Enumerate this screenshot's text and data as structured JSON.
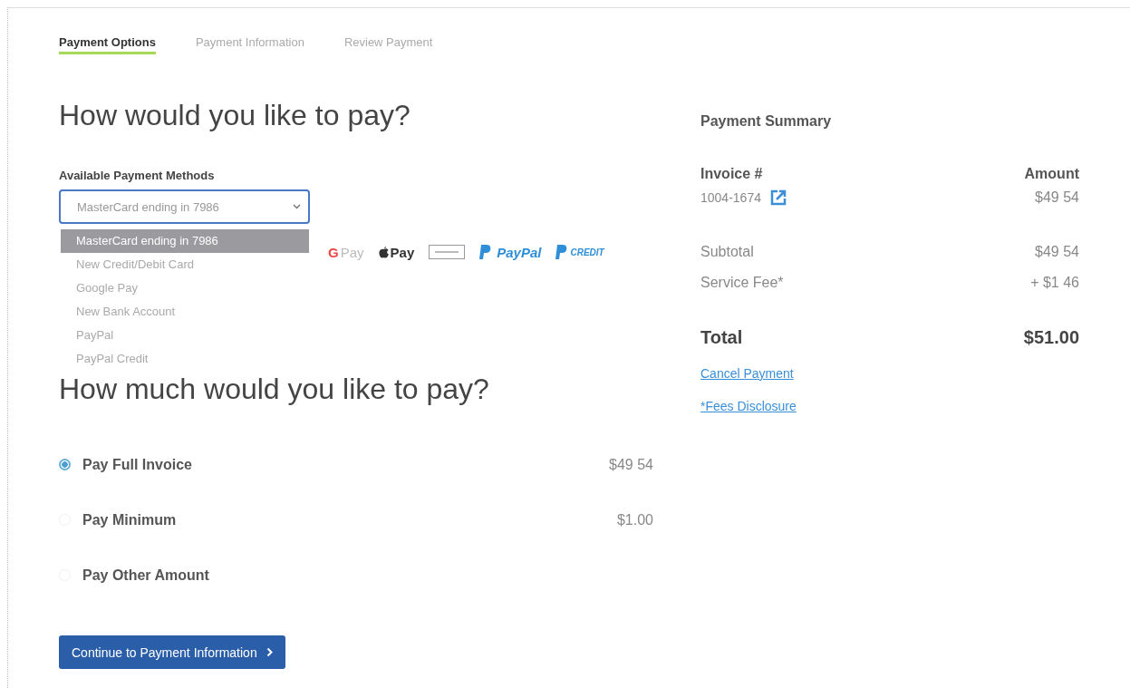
{
  "tabs": [
    {
      "label": "Payment Options",
      "selected": true
    },
    {
      "label": "Payment Information",
      "selected": false
    },
    {
      "label": "Review Payment",
      "selected": false
    }
  ],
  "method_section": {
    "heading": "How would you like to pay?",
    "label": "Available Payment Methods",
    "select": {
      "value": "MasterCard ending in 7986",
      "expanded": true
    },
    "options": [
      {
        "label": "MasterCard ending in 7986",
        "selected": true
      },
      {
        "label": "New Credit/Debit Card",
        "selected": false
      },
      {
        "label": "Google Pay",
        "selected": false
      },
      {
        "label": "New Bank Account",
        "selected": false
      },
      {
        "label": "PayPal",
        "selected": false
      },
      {
        "label": "PayPal Credit",
        "selected": false
      }
    ],
    "logos": [
      {
        "kind": "gpay",
        "mark": "G",
        "text": "Pay"
      },
      {
        "kind": "applepay",
        "text": "Pay"
      },
      {
        "kind": "card"
      },
      {
        "kind": "paypal",
        "text": "PayPal"
      },
      {
        "kind": "paypal_credit",
        "text": "CREDIT"
      }
    ]
  },
  "amount_section": {
    "heading": "How much would you like to pay?",
    "options": [
      {
        "label": "Pay Full Invoice",
        "amount": "$49 54",
        "selected": true
      },
      {
        "label": "Pay Minimum",
        "amount": "$1.00",
        "selected": false
      },
      {
        "label": "Pay Other Amount",
        "selected": false
      }
    ],
    "button": "Continue to Payment Information"
  },
  "summary": {
    "title": "Payment Summary",
    "columns": [
      "Invoice #",
      "Amount"
    ],
    "invoices": [
      {
        "number": "1004-1674",
        "amount": "$49 54"
      }
    ],
    "lines": [
      {
        "label": "Subtotal",
        "value": "$49 54"
      },
      {
        "label": "Service Fee*",
        "value": "+ $1 46"
      }
    ],
    "total": {
      "label": "Total",
      "value": "$51.00"
    },
    "links": [
      "Cancel Payment",
      "*Fees Disclosure"
    ]
  }
}
